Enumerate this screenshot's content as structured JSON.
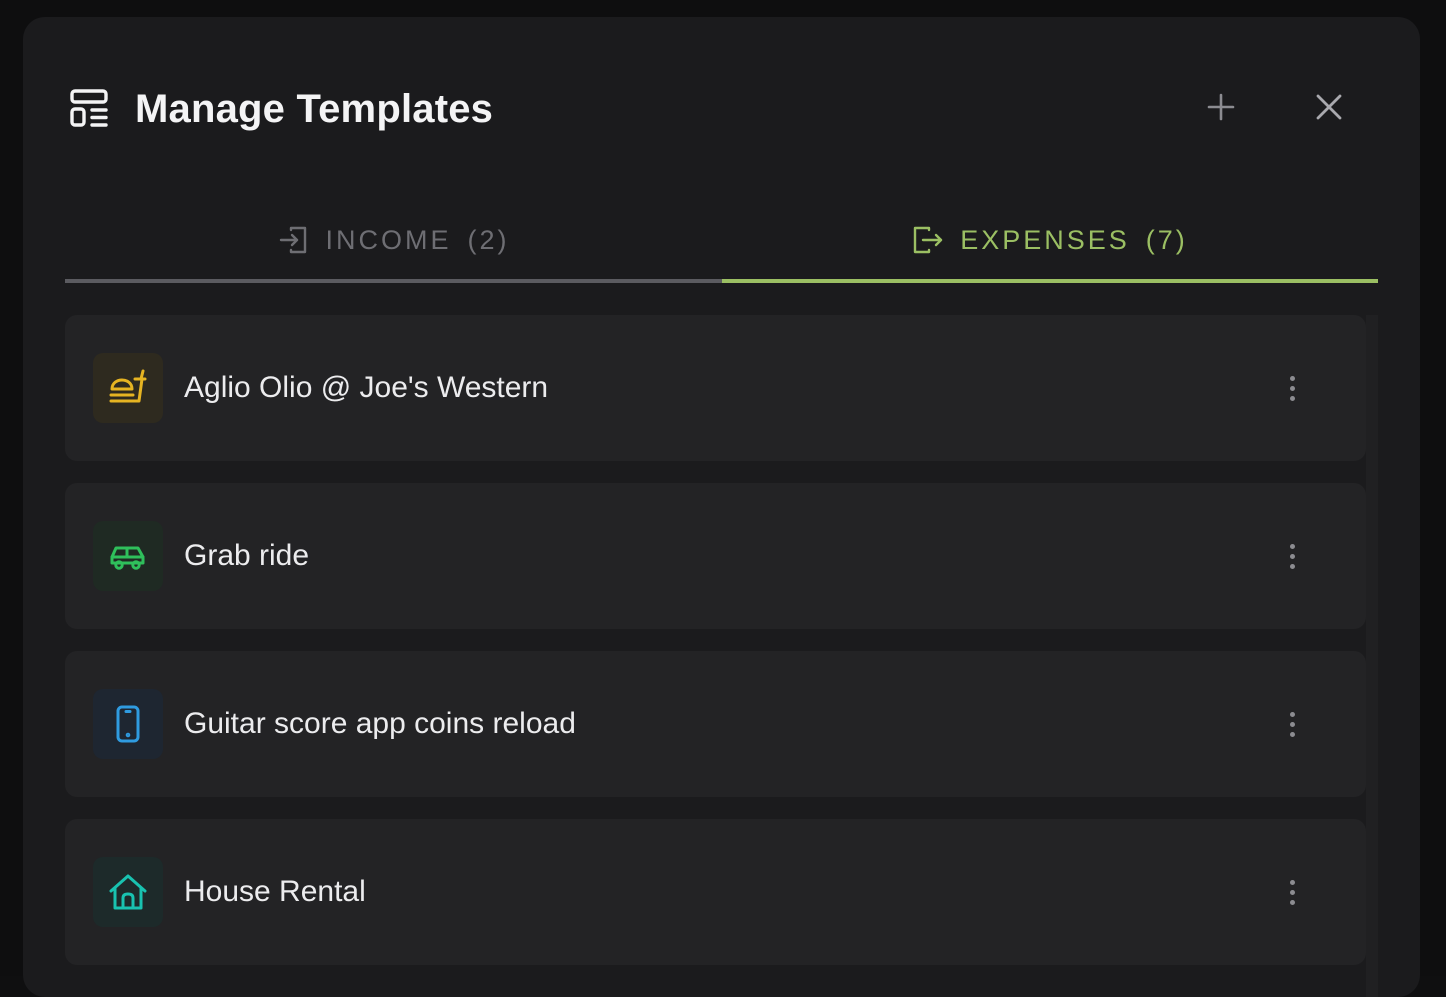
{
  "header": {
    "title": "Manage Templates",
    "title_icon": "template-icon",
    "add_icon": "plus-icon",
    "close_icon": "close-icon"
  },
  "tabs": [
    {
      "icon": "login-icon",
      "label": "INCOME",
      "count": "(2)",
      "active": false
    },
    {
      "icon": "logout-icon",
      "label": "EXPENSES",
      "count": "(7)",
      "active": true
    }
  ],
  "colors": {
    "accent": "#9bbf63",
    "food": "#e6b422",
    "transport": "#2fbf5b",
    "phone": "#2f9be0",
    "home": "#19c2b0"
  },
  "templates": [
    {
      "label": "Aglio Olio @ Joe's Western",
      "icon": "food-icon",
      "color": "#e6b422",
      "bg": "#2e2a1f"
    },
    {
      "label": "Grab ride",
      "icon": "car-icon",
      "color": "#2fbf5b",
      "bg": "#1f2a23"
    },
    {
      "label": "Guitar score app coins reload",
      "icon": "smartphone-icon",
      "color": "#2f9be0",
      "bg": "#1e2631"
    },
    {
      "label": "House Rental",
      "icon": "home-icon",
      "color": "#19c2b0",
      "bg": "#1d2a2a"
    }
  ]
}
